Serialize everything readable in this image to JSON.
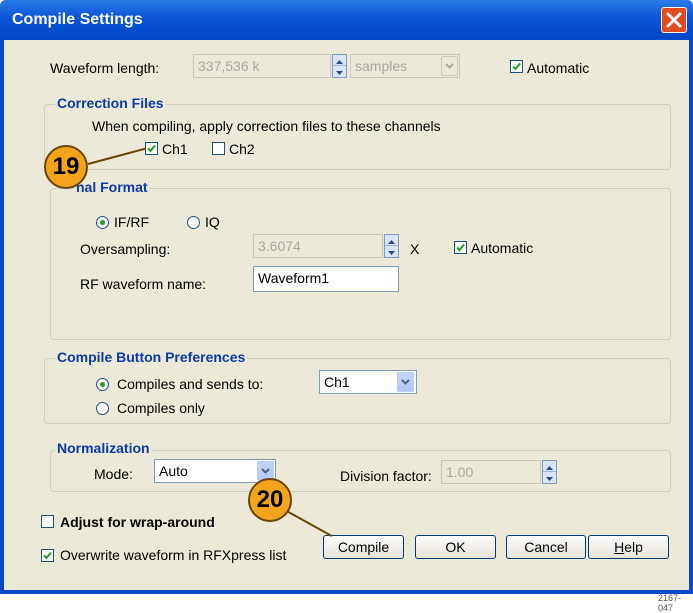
{
  "window": {
    "title": "Compile Settings",
    "close_label": "✕"
  },
  "waveform": {
    "label": "Waveform length:",
    "value": "337,536 k",
    "unit": "samples",
    "automatic_label": "Automatic",
    "automatic_checked": true
  },
  "correction": {
    "legend": "Correction Files",
    "description": "When compiling, apply correction files to these channels",
    "ch1_label": "Ch1",
    "ch1_checked": true,
    "ch2_label": "Ch2",
    "ch2_checked": false
  },
  "signal": {
    "legend": "Signal Format",
    "legend_visible_part": "nal Format",
    "ifrf_label": "IF/RF",
    "iq_label": "IQ",
    "selected": "IF/RF",
    "oversampling_label": "Oversampling:",
    "oversampling_value": "3.6074",
    "x_label": "X",
    "automatic_label": "Automatic",
    "automatic_checked": true,
    "rf_name_label": "RF waveform name:",
    "rf_name_value": "Waveform1"
  },
  "compile_prefs": {
    "legend": "Compile Button Preferences",
    "sends_label": "Compiles and sends to:",
    "sends_target": "Ch1",
    "only_label": "Compiles only",
    "selected": "Compiles and sends to:"
  },
  "normalization": {
    "legend": "Normalization",
    "mode_label": "Mode:",
    "mode_value": "Auto",
    "division_label": "Division factor:",
    "division_value": "1.00"
  },
  "options": {
    "wrap_label": "Adjust for wrap-around",
    "wrap_checked": false,
    "overwrite_label": "Overwrite waveform in RFXpress list",
    "overwrite_checked": true
  },
  "buttons": {
    "compile": "Compile",
    "ok": "OK",
    "cancel": "Cancel",
    "help_accel": "H",
    "help_rest": "elp"
  },
  "callouts": {
    "a": "19",
    "b": "20"
  },
  "figure_ref": "2167-047",
  "colors": {
    "title_bar": "#0a55d6",
    "dialog_bg": "#ece9d8",
    "legend_text": "#0b3aa8",
    "callout_fill": "#f3a31c"
  }
}
